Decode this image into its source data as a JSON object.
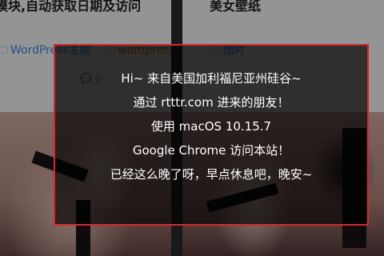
{
  "cards": [
    {
      "title": "模块,自动获取日期及访问",
      "tags": [
        {
          "icon": "folder-icon",
          "label": "WordPress主题"
        },
        {
          "icon": "folder-icon",
          "label": "wordpress"
        }
      ],
      "meta_icon": "comment-icon",
      "meta_value": "0"
    },
    {
      "title": "美女壁纸",
      "tags": [
        {
          "icon": "folder-icon",
          "label": "图片"
        }
      ]
    }
  ],
  "welcome": {
    "lines": [
      "Hi~ 来自美国加利福尼亚州硅谷~",
      "通过 rtttr.com 进来的朋友！",
      "使用 macOS 10.15.7",
      "Google Chrome 访问本站！",
      "已经这么晚了呀，早点休息吧，晚安~"
    ]
  },
  "colors": {
    "link_blue": "#3c8dde",
    "tag_orange": "#e07a2e",
    "popup_border": "#d6282a"
  }
}
